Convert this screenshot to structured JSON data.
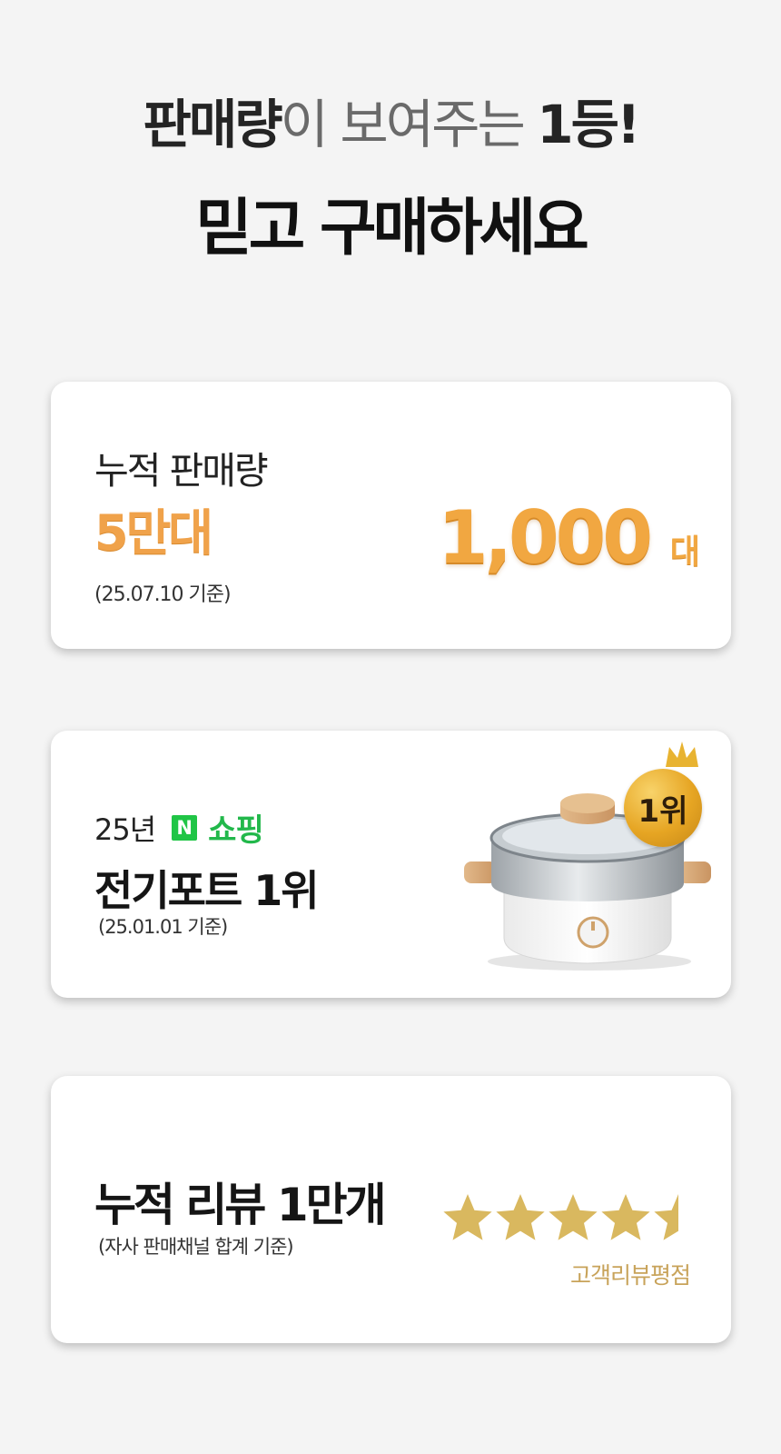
{
  "header": {
    "headline_strong": "판매량",
    "headline_light": "이 보여주는 ",
    "headline_rank": "1등!",
    "subhead": "믿고 구매하세요"
  },
  "sales_card": {
    "label": "누적 판매량",
    "highlight": "5만대",
    "date": "(25.07.10 기준)",
    "number": "1,000",
    "unit": "대"
  },
  "rank_card": {
    "year": "25년",
    "naver_logo": "N",
    "naver_shopping": "쇼핑",
    "title": "전기포트 1위",
    "date": "(25.01.01 기준)",
    "badge": "1위",
    "product_icon": "electric-pot-image",
    "crown_icon": "crown-icon"
  },
  "review_card": {
    "title": "누적 리뷰 1만개",
    "note": "(자사 판매채널 합계 기준)",
    "rating": 4.5,
    "stars_total": 5,
    "caption": "고객리뷰평점"
  },
  "colors": {
    "background": "#f4f4f4",
    "gold": "#f1a741",
    "naver_green": "#20c546",
    "star_gold": "#d9b85f"
  }
}
